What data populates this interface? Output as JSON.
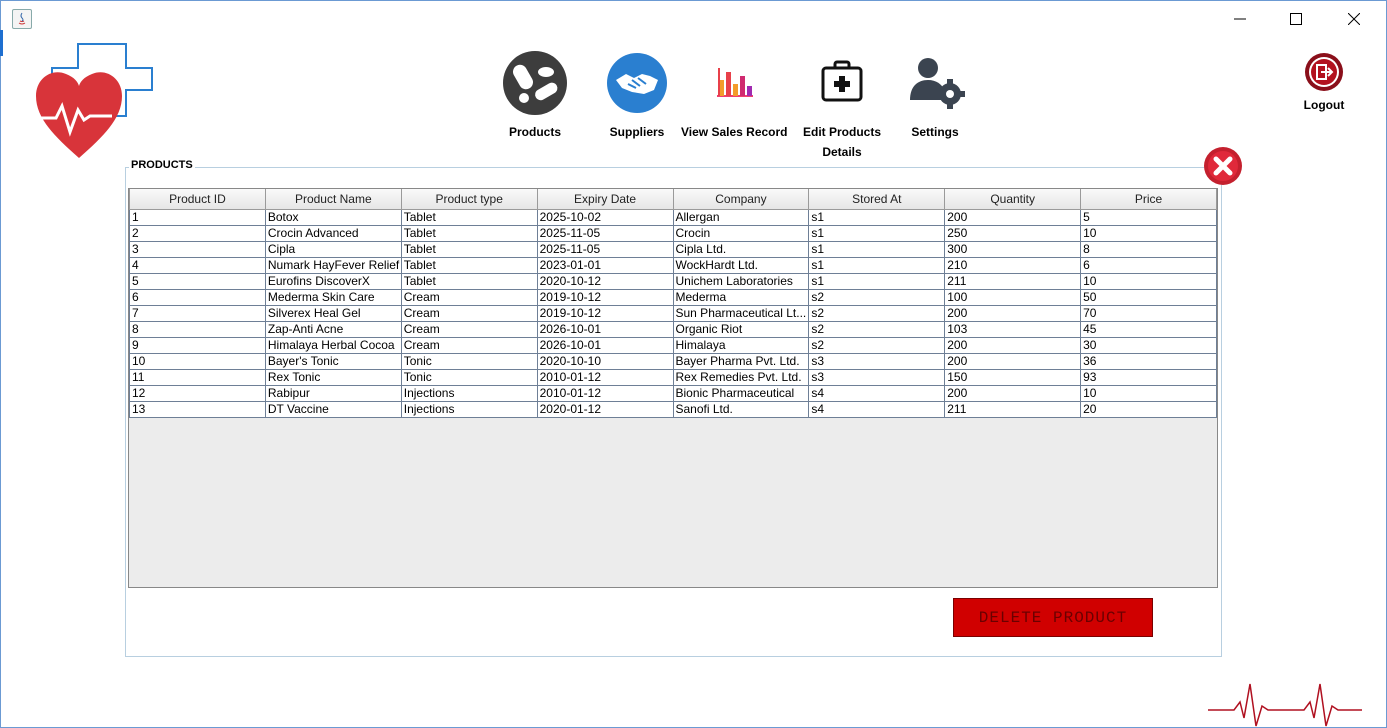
{
  "window": {
    "title": ""
  },
  "nav": [
    {
      "label": "Products",
      "icon": "pills-icon"
    },
    {
      "label": "Suppliers",
      "icon": "handshake-icon"
    },
    {
      "label": "View Sales Record",
      "icon": "bar-chart-icon"
    },
    {
      "label": "Edit Products",
      "label2": "Details",
      "icon": "first-aid-kit-icon"
    },
    {
      "label": "Settings",
      "icon": "user-gear-icon"
    }
  ],
  "logout": {
    "label": "Logout"
  },
  "panel": {
    "title": "PRODUCTS"
  },
  "table": {
    "columns": [
      "Product ID",
      "Product Name",
      "Product type",
      "Expiry Date",
      "Company",
      "Stored At",
      "Quantity",
      "Price"
    ],
    "rows": [
      [
        "1",
        "Botox",
        "Tablet",
        "2025-10-02",
        "Allergan",
        "s1",
        "200",
        "5"
      ],
      [
        "2",
        "Crocin Advanced",
        "Tablet",
        "2025-11-05",
        "Crocin",
        "s1",
        "250",
        "10"
      ],
      [
        "3",
        "Cipla",
        "Tablet",
        "2025-11-05",
        "Cipla Ltd.",
        "s1",
        "300",
        "8"
      ],
      [
        "4",
        "Numark HayFever Relief",
        "Tablet",
        "2023-01-01",
        "WockHardt Ltd.",
        "s1",
        "210",
        "6"
      ],
      [
        "5",
        "Eurofins DiscoverX",
        "Tablet",
        "2020-10-12",
        "Unichem Laboratories",
        "s1",
        "211",
        "10"
      ],
      [
        "6",
        "Mederma Skin Care",
        "Cream",
        "2019-10-12",
        "Mederma",
        "s2",
        "100",
        "50"
      ],
      [
        "7",
        "Silverex Heal Gel",
        "Cream",
        "2019-10-12",
        "Sun Pharmaceutical Lt...",
        "s2",
        "200",
        "70"
      ],
      [
        "8",
        "Zap-Anti Acne",
        "Cream",
        "2026-10-01",
        "Organic Riot",
        "s2",
        "103",
        "45"
      ],
      [
        "9",
        "Himalaya Herbal Cocoa",
        "Cream",
        "2026-10-01",
        "Himalaya",
        "s2",
        "200",
        "30"
      ],
      [
        "10",
        "Bayer's Tonic",
        "Tonic",
        "2020-10-10",
        "Bayer Pharma Pvt. Ltd.",
        "s3",
        "200",
        "36"
      ],
      [
        "11",
        "Rex Tonic",
        "Tonic",
        "2010-01-12",
        "Rex Remedies Pvt. Ltd.",
        "s3",
        "150",
        "93"
      ],
      [
        "12",
        "Rabipur",
        "Injections",
        "2010-01-12",
        "Bionic Pharmaceutical",
        "s4",
        "200",
        "10"
      ],
      [
        "13",
        "DT Vaccine",
        "Injections",
        "2020-01-12",
        "Sanofi Ltd.",
        "s4",
        "211",
        "20"
      ]
    ]
  },
  "delete_button": {
    "label": "DELETE PRODUCT"
  },
  "colors": {
    "accent_red": "#d00000",
    "brand_blue": "#2a7fd0",
    "frame": "#6b9ad3"
  }
}
